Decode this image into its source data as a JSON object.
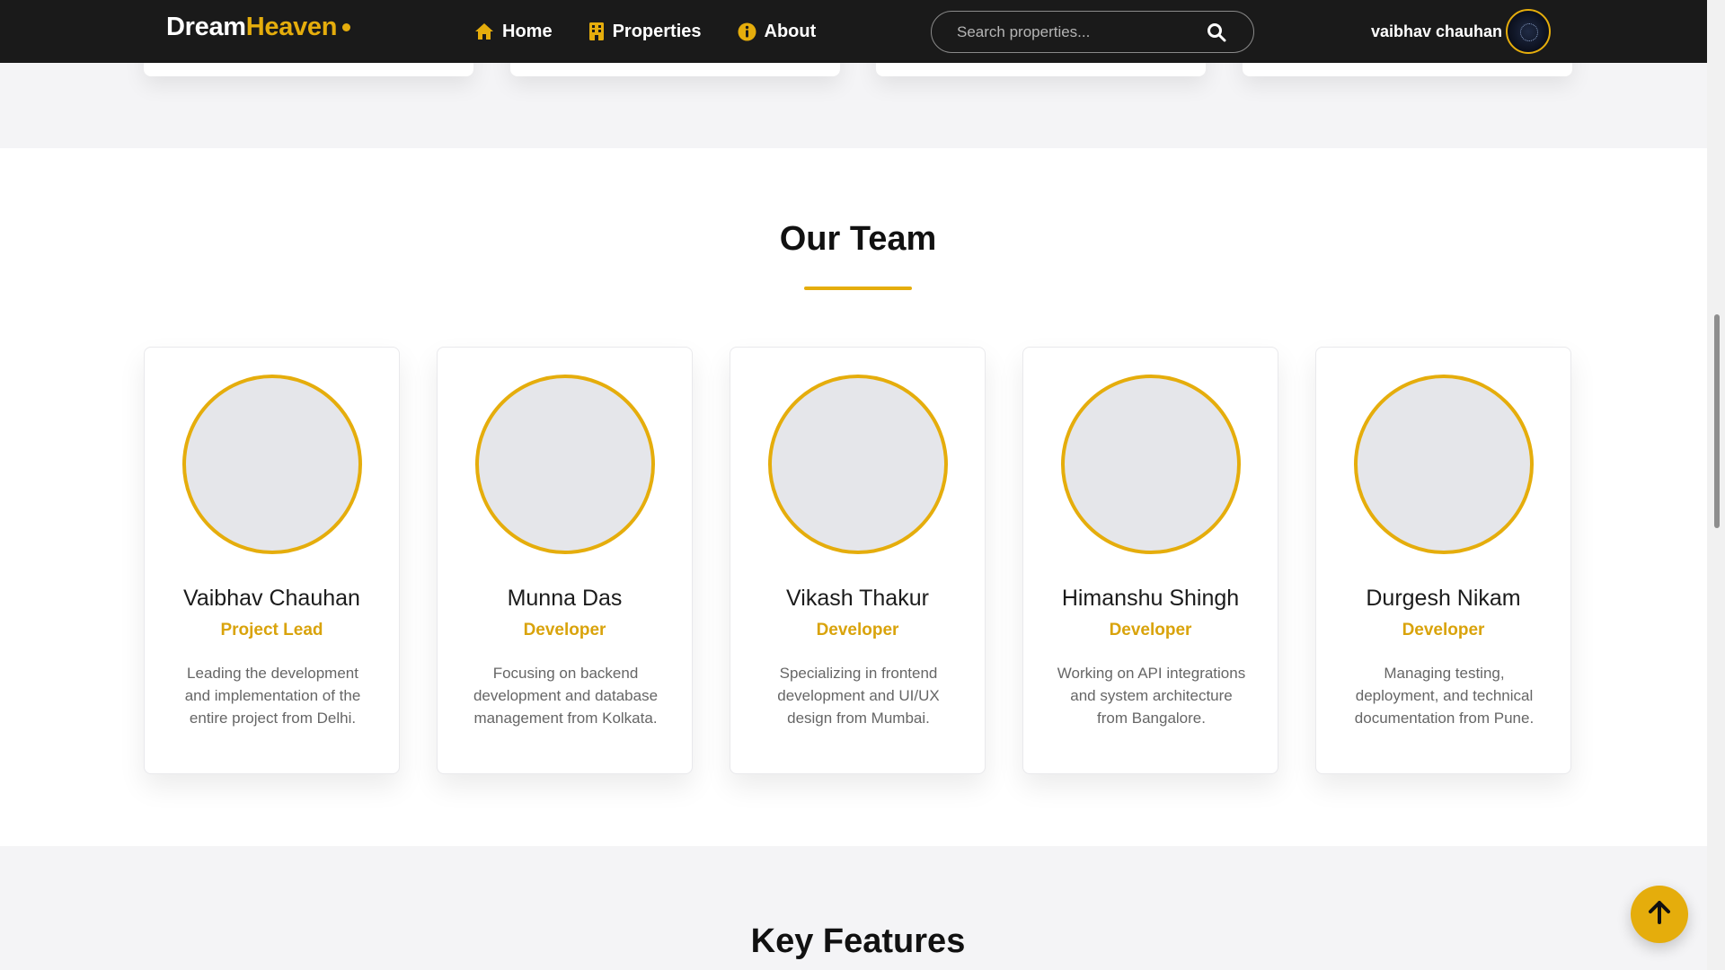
{
  "brand": {
    "name_part1": "Dream",
    "name_part2": "Heaven"
  },
  "nav": {
    "items": [
      {
        "label": "Home",
        "icon": "home-icon"
      },
      {
        "label": "Properties",
        "icon": "building-icon"
      },
      {
        "label": "About",
        "icon": "info-circle-icon"
      }
    ]
  },
  "search": {
    "placeholder": "Search properties...",
    "value": ""
  },
  "user": {
    "name": "vaibhav chauhan"
  },
  "team_section": {
    "title": "Our Team",
    "members": [
      {
        "name": "Vaibhav Chauhan",
        "role": "Project Lead",
        "description": "Leading the development and implementation of the entire project from Delhi."
      },
      {
        "name": "Munna Das",
        "role": "Developer",
        "description": "Focusing on backend development and database management from Kolkata."
      },
      {
        "name": "Vikash Thakur",
        "role": "Developer",
        "description": "Specializing in frontend development and UI/UX design from Mumbai."
      },
      {
        "name": "Himanshu Shingh",
        "role": "Developer",
        "description": "Working on API integrations and system architecture from Bangalore."
      },
      {
        "name": "Durgesh Nikam",
        "role": "Developer",
        "description": "Managing testing, deployment, and technical documentation from Pune."
      }
    ]
  },
  "features_section": {
    "title": "Key Features"
  },
  "colors": {
    "accent": "#e5ad0c",
    "navbar": "#1a1a1a",
    "section_bg": "#f4f4f6"
  }
}
